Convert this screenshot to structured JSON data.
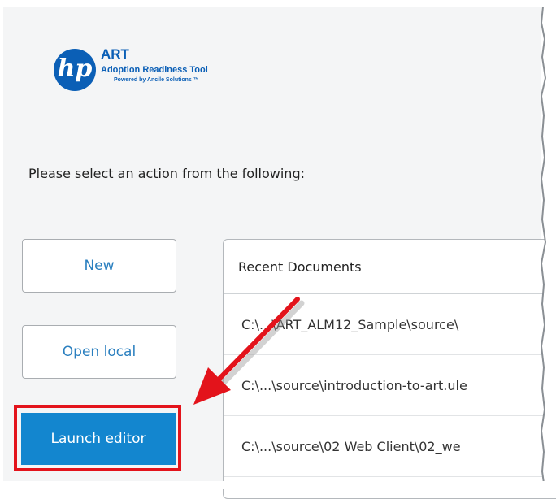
{
  "logo": {
    "mark": "hp",
    "title": "ART",
    "subtitle": "Adoption Readiness Tool",
    "powered_by": "Powered by Ancile Solutions ™"
  },
  "prompt": "Please select an action from the following:",
  "buttons": {
    "new": "New",
    "open_local": "Open local",
    "launch_editor": "Launch editor"
  },
  "recent": {
    "header": "Recent Documents",
    "items": [
      "C:\\...\\ART_ALM12_Sample\\source\\",
      "C:\\...\\source\\introduction-to-art.ule",
      "C:\\...\\source\\02 Web Client\\02_we"
    ]
  },
  "colors": {
    "accent_blue": "#1386cf",
    "hp_blue": "#0b5fb6",
    "highlight_red": "#e3131b"
  }
}
